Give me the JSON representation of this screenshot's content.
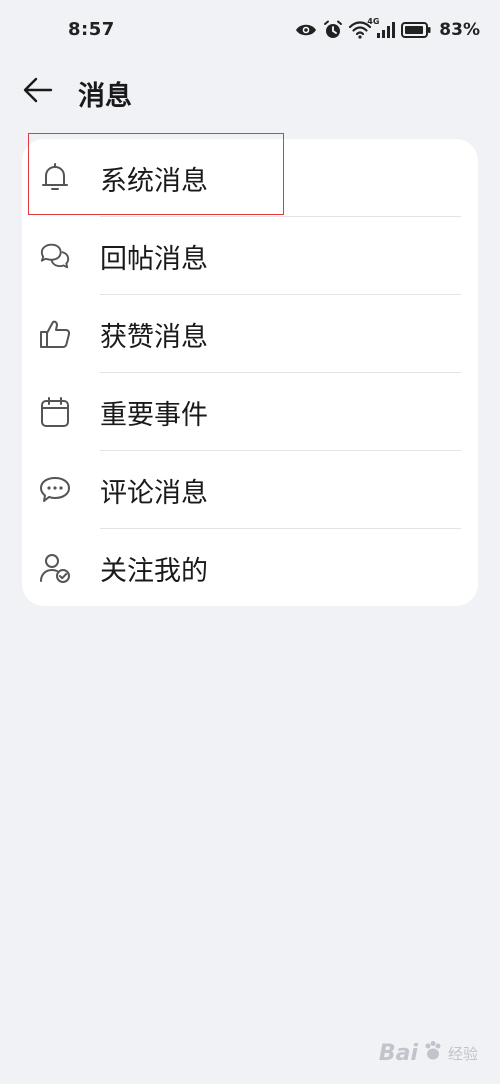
{
  "status_bar": {
    "time": "8:57",
    "network_label": "4G",
    "battery_percent": "83%",
    "icons": [
      "eye-icon",
      "alarm-icon",
      "wifi-icon",
      "signal-icon",
      "battery-icon"
    ]
  },
  "header": {
    "title": "消息",
    "back_icon": "arrow-left-icon"
  },
  "list": {
    "items": [
      {
        "label": "系统消息",
        "icon": "bell-icon"
      },
      {
        "label": "回帖消息",
        "icon": "chat-bubbles-icon"
      },
      {
        "label": "获赞消息",
        "icon": "thumbs-up-icon"
      },
      {
        "label": "重要事件",
        "icon": "calendar-icon"
      },
      {
        "label": "评论消息",
        "icon": "comment-icon"
      },
      {
        "label": "关注我的",
        "icon": "user-check-icon"
      }
    ]
  },
  "annotation": {
    "highlight_color": "#e23b3b"
  },
  "watermark": {
    "brand": "Bai",
    "sub": "经验"
  },
  "colors": {
    "background": "#f1f2f5",
    "card": "#ffffff",
    "text": "#1a1a1a",
    "icon": "#555555"
  }
}
